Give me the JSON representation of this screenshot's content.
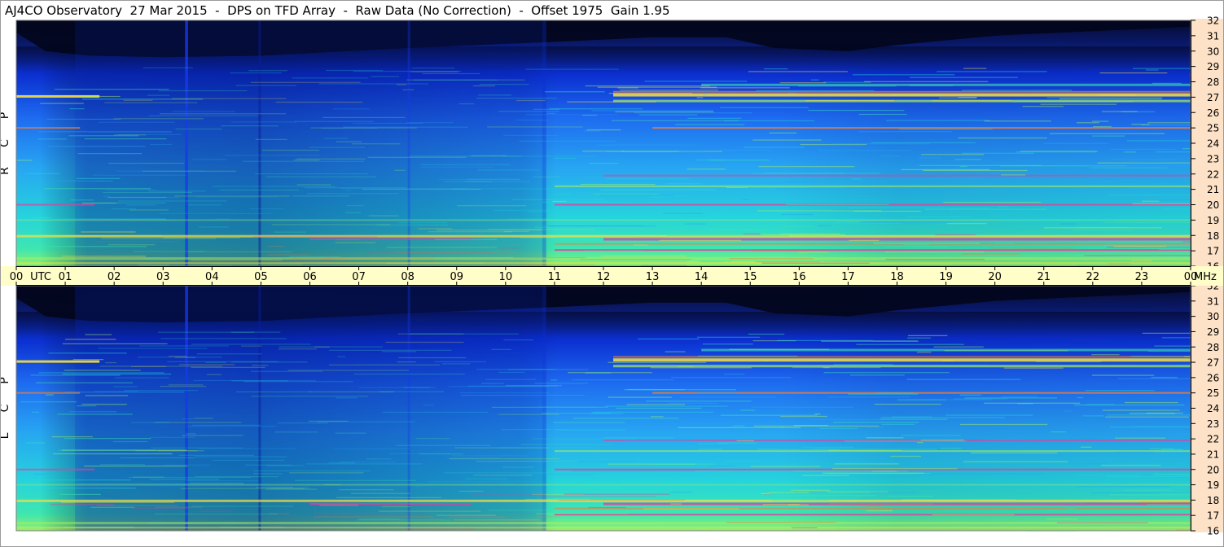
{
  "title": "AJ4CO Observatory  27 Mar 2015  -  DPS on TFD Array  -  Raw Data (No Correction)  -  Offset 1975  Gain 1.95",
  "chart_data": {
    "type": "heatmap",
    "x_axis": {
      "unit_label": "UTC",
      "ticks": [
        "00",
        "01",
        "02",
        "03",
        "04",
        "05",
        "06",
        "07",
        "08",
        "09",
        "10",
        "11",
        "12",
        "13",
        "14",
        "15",
        "16",
        "17",
        "18",
        "19",
        "20",
        "21",
        "22",
        "23",
        "00"
      ],
      "range_hours": [
        0,
        24
      ]
    },
    "y_axis": {
      "unit_label": "MHz",
      "ticks": [
        "16",
        "17",
        "18",
        "19",
        "20",
        "21",
        "22",
        "23",
        "24",
        "25",
        "26",
        "27",
        "28",
        "29",
        "30",
        "31",
        "32"
      ],
      "range_mhz": [
        16,
        32
      ]
    },
    "panels": [
      {
        "label": [
          "R",
          "C",
          "P"
        ]
      },
      {
        "label": [
          "L",
          "C",
          "P"
        ]
      }
    ],
    "colormap": [
      "#050a28",
      "#0a1a6e",
      "#0b2fd0",
      "#1e6cf0",
      "#27a6f2",
      "#25d4dc",
      "#3ee6b0",
      "#a8f060",
      "#f8e040",
      "#f07c3c",
      "#e83c9c",
      "#c828e0"
    ],
    "grid": false,
    "legend": "none"
  },
  "colors": {
    "axis_band": "#fde2c7",
    "time_band": "#fffec8",
    "frame": "#000000"
  }
}
